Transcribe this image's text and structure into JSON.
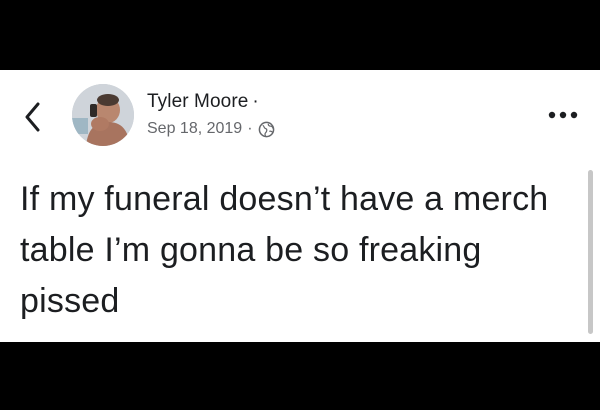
{
  "post": {
    "author_name": "Tyler Moore",
    "author_separator": "·",
    "date": "Sep 18, 2019",
    "meta_separator": "·",
    "visibility_icon": "globe-icon",
    "text": "If my funeral doesn’t have a merch table I’m gonna be so freaking pissed"
  },
  "icons": {
    "back": "chevron-left-icon",
    "more": "more-horizontal-icon",
    "avatar": "avatar"
  },
  "colors": {
    "frame": "#000000",
    "card": "#ffffff",
    "text_primary": "#1c1e21",
    "text_secondary": "#65676b"
  }
}
